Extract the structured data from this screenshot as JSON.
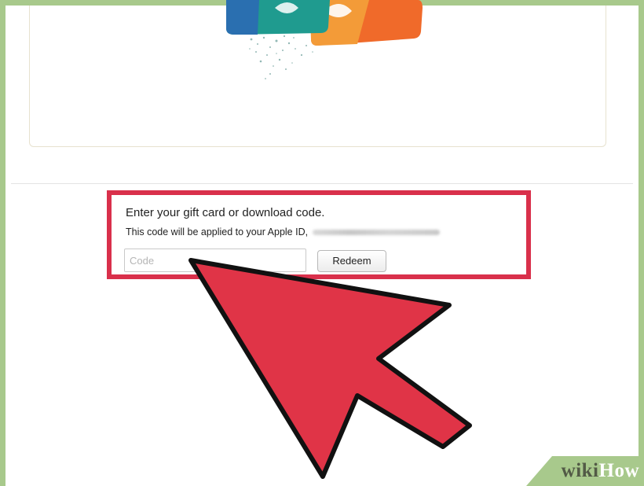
{
  "redeem_panel": {
    "heading": "Enter your gift card or download code.",
    "subtext": "This code will be applied to your Apple ID,",
    "code_input": {
      "value": "",
      "placeholder": "Code"
    },
    "redeem_button_label": "Redeem"
  },
  "watermark": {
    "wiki": "wiki",
    "how": "How"
  },
  "colors": {
    "frame_border": "#a8c98c",
    "highlight_box": "#d9304b",
    "arrow_fill": "#d9304b"
  },
  "icons": {
    "pointer": "pointer-arrow-icon",
    "gift_cards": "gift-cards-illustration"
  }
}
